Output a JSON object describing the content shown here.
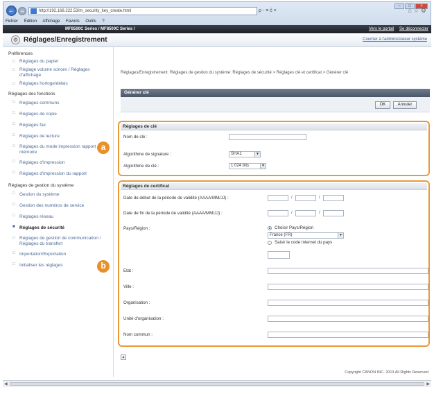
{
  "browser": {
    "url": "http://192.168.222.53/m_security_key_create.html",
    "search_label": "ρ - ≡ ć ×",
    "menu": [
      "Fichier",
      "Édition",
      "Affichage",
      "Favoris",
      "Outils",
      "?"
    ]
  },
  "device_bar": {
    "name": "MF8500C Series / MF8500C Series /",
    "portal_link": "Vers le portail",
    "logout_link": "Se déconnecter"
  },
  "header": {
    "title": "Réglages/Enregistrement",
    "admin_link": "Courrier à l'administrateur système"
  },
  "sidebar": {
    "sections": [
      {
        "title": "Préférences",
        "items": [
          "Réglages du papier",
          "Réglage volume sonore / Réglages d'affichage",
          "Réglages horloge/délais"
        ]
      },
      {
        "title": "Réglages des fonctions",
        "items": [
          "Réglages communs",
          "Réglages de copie",
          "Réglages fax",
          "Réglages de lecture",
          "Réglages du mode impression rapport mémoire",
          "Réglages d'impression",
          "Réglages d'impression du rapport"
        ]
      },
      {
        "title": "Réglages de gestion du système",
        "items": [
          "Gestion du système",
          "Gestion des numéros de service",
          "Réglages réseau",
          "Réglages de sécurité",
          "Réglages de gestion de communication / Réglages du transfert",
          "Importation/Exportation",
          "Initialiser les réglages"
        ]
      }
    ]
  },
  "main": {
    "breadcrumb": "Réglages/Enregistrement: Réglages de gestion du système: Réglages de sécurité > Réglages clé et certificat > Générer clé",
    "page_title": "Générer clé",
    "ok_label": "OK",
    "cancel_label": "Annuler",
    "key_panel": {
      "title": "Réglages de clé",
      "key_name_label": "Nom de clé :",
      "key_name_value": "",
      "signature_label": "Algorithme de signature :",
      "signature_value": "SHA1",
      "key_algo_label": "Algorithme de clé :",
      "key_algo_value": "1 024 bits"
    },
    "cert_panel": {
      "title": "Réglages de certificat",
      "start_label": "Date de début de la période de validité (AAAA/MM/JJ) :",
      "end_label": "Date de fin de la période de validité (AAAA/MM/JJ) :",
      "country_label": "Pays/Région :",
      "choose_country": "Choisir Pays/Région",
      "country_value": "France (FR)",
      "enter_code": "Saisir le code Internet du pays",
      "state_label": "Etat :",
      "city_label": "Ville :",
      "org_label": "Organisation :",
      "unit_label": "Unité d'organisation :",
      "common_label": "Nom commun :",
      "date_sep": "/"
    },
    "callouts": [
      "a",
      "b"
    ],
    "copyright": "Copyright CANON INC. 2013 All Rights Reserved"
  },
  "colors": {
    "accent_orange": "#e79a3a",
    "title_bar": "#4a5666"
  }
}
